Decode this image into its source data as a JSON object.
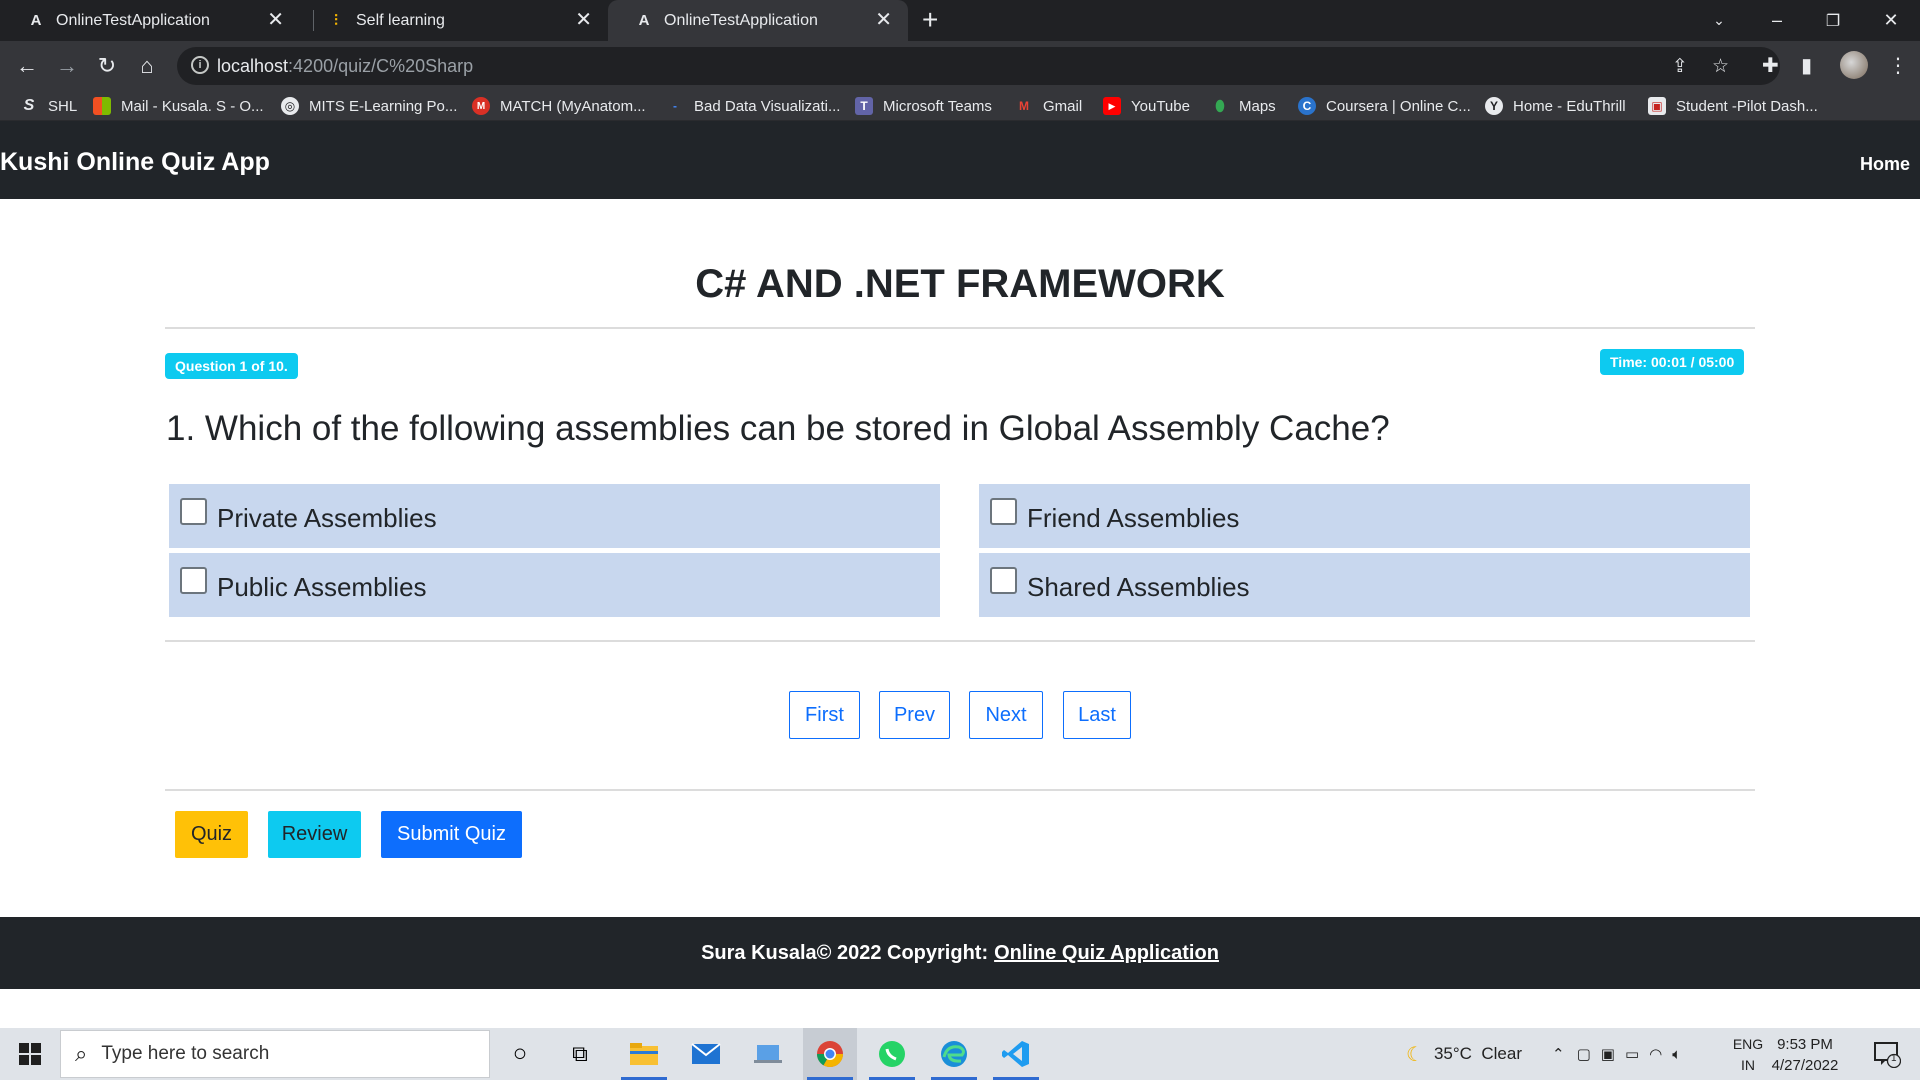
{
  "browser": {
    "tabs": [
      {
        "title": "OnlineTestApplication",
        "favicon": "angular-icon",
        "active": false
      },
      {
        "title": "Self learning",
        "favicon": "chart-icon",
        "active": false
      },
      {
        "title": "OnlineTestApplication",
        "favicon": "angular-icon",
        "active": true
      }
    ],
    "url_host": "localhost",
    "url_rest": ":4200/quiz/C%20Sharp",
    "bookmarks": [
      {
        "label": "SHL",
        "icon": "S"
      },
      {
        "label": "Mail - Kusala. S - O...",
        "icon": "ms"
      },
      {
        "label": "MITS E-Learning Po...",
        "icon": "globe"
      },
      {
        "label": "MATCH (MyAnatom...",
        "icon": "M"
      },
      {
        "label": "Bad Data Visualizati...",
        "icon": "-"
      },
      {
        "label": "Microsoft Teams",
        "icon": "T"
      },
      {
        "label": "Gmail",
        "icon": "M"
      },
      {
        "label": "YouTube",
        "icon": "yt"
      },
      {
        "label": "Maps",
        "icon": "pin"
      },
      {
        "label": "Coursera | Online C...",
        "icon": "C"
      },
      {
        "label": "Home - EduThrill",
        "icon": "Y"
      },
      {
        "label": "Student -Pilot Dash...",
        "icon": "img"
      }
    ]
  },
  "app": {
    "brand": "Kushi Online Quiz App",
    "nav_home": "Home",
    "quiz_title": "C# AND .NET FRAMEWORK",
    "question_badge": "Question 1 of 10.",
    "timer_badge": "Time: 00:01 / 05:00",
    "question_text": "1. Which of the following assemblies can be stored in Global Assembly Cache?",
    "options": [
      "Private Assemblies",
      "Friend Assemblies",
      "Public Assemblies",
      "Shared Assemblies"
    ],
    "pager": {
      "first": "First",
      "prev": "Prev",
      "next": "Next",
      "last": "Last"
    },
    "actions": {
      "quiz": "Quiz",
      "review": "Review",
      "submit": "Submit Quiz"
    },
    "footer_text": "Sura Kusala© 2022 Copyright:",
    "footer_link": "Online Quiz Application"
  },
  "taskbar": {
    "search_placeholder": "Type here to search",
    "weather": "35°C  Clear",
    "lang_top": "ENG",
    "lang_bottom": "IN",
    "time": "9:53 PM",
    "date": "4/27/2022",
    "notification_count": "1"
  },
  "colors": {
    "navbar": "#212529",
    "option_bg": "#c8d7ee",
    "badge": "#0dcaf0",
    "primary": "#0d6efd",
    "warning": "#ffc107"
  }
}
